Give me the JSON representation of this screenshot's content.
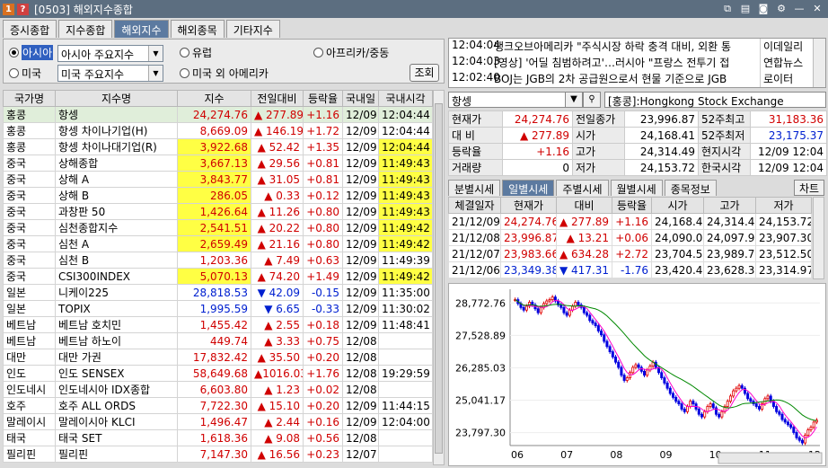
{
  "window": {
    "title": "[0503] 해외지수종합",
    "icon1": "1",
    "icon2": "?"
  },
  "tabs": [
    "증시종합",
    "지수종합",
    "해외지수",
    "해외종목",
    "기타지수"
  ],
  "filter": {
    "radio1": "아시아",
    "select1": "아시아 주요지수",
    "radio2": "유럽",
    "radio3": "아프리카/중동",
    "radio4": "미국",
    "select2": "미국 주요지수",
    "radio5": "미국 외 아메리카",
    "query": "조회"
  },
  "grid": {
    "headers": [
      "국가명",
      "지수명",
      "지수",
      "전일대비",
      "등락율",
      "국내일",
      "국내시각"
    ],
    "rows": [
      {
        "country": "홍콩",
        "name": "항셍",
        "value": "24,274.76",
        "change": "▲ 277.89",
        "rate": "+1.16",
        "date": "12/09",
        "time": "12:04:44"
      },
      {
        "country": "홍콩",
        "name": "항셍 차이나기업(H)",
        "value": "8,669.09",
        "change": "▲ 146.19",
        "rate": "+1.72",
        "date": "12/09",
        "time": "12:04:44"
      },
      {
        "country": "홍콩",
        "name": "항셍 차이나대기업(R)",
        "value": "3,922.68",
        "change": "▲ 52.42",
        "rate": "+1.35",
        "date": "12/09",
        "time": "12:04:44"
      },
      {
        "country": "중국",
        "name": "상해종합",
        "value": "3,667.13",
        "change": "▲ 29.56",
        "rate": "+0.81",
        "date": "12/09",
        "time": "11:49:43"
      },
      {
        "country": "중국",
        "name": "상해 A",
        "value": "3,843.77",
        "change": "▲ 31.05",
        "rate": "+0.81",
        "date": "12/09",
        "time": "11:49:43"
      },
      {
        "country": "중국",
        "name": "상해 B",
        "value": "286.05",
        "change": "▲ 0.33",
        "rate": "+0.12",
        "date": "12/09",
        "time": "11:49:43"
      },
      {
        "country": "중국",
        "name": "과창판 50",
        "value": "1,426.64",
        "change": "▲ 11.26",
        "rate": "+0.80",
        "date": "12/09",
        "time": "11:49:43"
      },
      {
        "country": "중국",
        "name": "심천종합지수",
        "value": "2,541.51",
        "change": "▲ 20.22",
        "rate": "+0.80",
        "date": "12/09",
        "time": "11:49:42"
      },
      {
        "country": "중국",
        "name": "심천 A",
        "value": "2,659.49",
        "change": "▲ 21.16",
        "rate": "+0.80",
        "date": "12/09",
        "time": "11:49:42"
      },
      {
        "country": "중국",
        "name": "심천 B",
        "value": "1,203.36",
        "change": "▲ 7.49",
        "rate": "+0.63",
        "date": "12/09",
        "time": "11:49:39"
      },
      {
        "country": "중국",
        "name": "CSI300INDEX",
        "value": "5,070.13",
        "change": "▲ 74.20",
        "rate": "+1.49",
        "date": "12/09",
        "time": "11:49:42"
      },
      {
        "country": "일본",
        "name": "니케이225",
        "value": "28,818.53",
        "change": "▼ 42.09",
        "rate": "-0.15",
        "date": "12/09",
        "time": "11:35:00"
      },
      {
        "country": "일본",
        "name": "TOPIX",
        "value": "1,995.59",
        "change": "▼ 6.65",
        "rate": "-0.33",
        "date": "12/09",
        "time": "11:30:02"
      },
      {
        "country": "베트남",
        "name": "베트남 호치민",
        "value": "1,455.42",
        "change": "▲ 2.55",
        "rate": "+0.18",
        "date": "12/09",
        "time": "11:48:41"
      },
      {
        "country": "베트남",
        "name": "베트남 하노이",
        "value": "449.74",
        "change": "▲ 3.33",
        "rate": "+0.75",
        "date": "12/08",
        "time": ""
      },
      {
        "country": "대만",
        "name": "대만 가권",
        "value": "17,832.42",
        "change": "▲ 35.50",
        "rate": "+0.20",
        "date": "12/08",
        "time": ""
      },
      {
        "country": "인도",
        "name": "인도 SENSEX",
        "value": "58,649.68",
        "change": "▲1016.03",
        "rate": "+1.76",
        "date": "12/08",
        "time": "19:29:59"
      },
      {
        "country": "인도네시",
        "name": "인도네시아 IDX종합",
        "value": "6,603.80",
        "change": "▲ 1.23",
        "rate": "+0.02",
        "date": "12/08",
        "time": ""
      },
      {
        "country": "호주",
        "name": "호주 ALL ORDS",
        "value": "7,722.30",
        "change": "▲ 15.10",
        "rate": "+0.20",
        "date": "12/09",
        "time": "11:44:15"
      },
      {
        "country": "말레이시",
        "name": "말레이시아 KLCI",
        "value": "1,496.47",
        "change": "▲ 2.44",
        "rate": "+0.16",
        "date": "12/09",
        "time": "12:04:00"
      },
      {
        "country": "태국",
        "name": "태국 SET",
        "value": "1,618.36",
        "change": "▲ 9.08",
        "rate": "+0.56",
        "date": "12/08",
        "time": ""
      },
      {
        "country": "필리핀",
        "name": "필리핀",
        "value": "7,147.30",
        "change": "▲ 16.56",
        "rate": "+0.23",
        "date": "12/07",
        "time": ""
      }
    ]
  },
  "news": [
    {
      "time": "12:04:04",
      "headline": "뱅크오브아메리카 \"주식시장 하락 충격 대비, 외환 통",
      "source": "이데일리"
    },
    {
      "time": "12:04:03",
      "headline": "[영상] '어딜 침범하려고'…러시아 \"프랑스 전투기 접",
      "source": "연합뉴스"
    },
    {
      "time": "12:02:40",
      "headline": "BOJ는 JGB의 2차 공급원으로서 현물 기준으로 JGB",
      "source": "로이터"
    }
  ],
  "search": {
    "value": "항셍",
    "exchange": "[홍콩]:Hongkong Stock Exchange"
  },
  "quote": {
    "rows": [
      [
        "현재가",
        "24,274.76",
        "전일종가",
        "23,996.87",
        "52주최고",
        "31,183.36"
      ],
      [
        "대 비",
        "▲ 277.89",
        "시가",
        "24,168.41",
        "52주최저",
        "23,175.37"
      ],
      [
        "등락율",
        "+1.16",
        "고가",
        "24,314.49",
        "현지시각",
        "12/09 12:04"
      ],
      [
        "거래량",
        "0",
        "저가",
        "24,153.72",
        "한국시각",
        "12/09 12:04"
      ]
    ]
  },
  "subtabs": [
    "분별시세",
    "일별시세",
    "주별시세",
    "월별시세",
    "종목정보"
  ],
  "chart_button": "차트",
  "daily": {
    "headers": [
      "체결일자",
      "현재가",
      "대비",
      "등락율",
      "시가",
      "고가",
      "저가"
    ],
    "rows": [
      [
        "21/12/09",
        "24,274.76",
        "▲ 277.89",
        "+1.16",
        "24,168.41",
        "24,314.49",
        "24,153.72"
      ],
      [
        "21/12/08",
        "23,996.87",
        "▲ 13.21",
        "+0.06",
        "24,090.02",
        "24,097.98",
        "23,907.30"
      ],
      [
        "21/12/07",
        "23,983.66",
        "▲ 634.28",
        "+2.72",
        "23,704.51",
        "23,989.78",
        "23,512.50"
      ],
      [
        "21/12/06",
        "23,349.38",
        "▼ 417.31",
        "-1.76",
        "23,420.44",
        "23,628.30",
        "23,314.97"
      ]
    ]
  },
  "chart_data": {
    "type": "candlestick",
    "yticks": [
      28772.76,
      27528.89,
      26285.03,
      25041.17,
      23797.3
    ],
    "ylim": [
      23300,
      29300
    ],
    "xticks": [
      "06",
      "07",
      "08",
      "09",
      "10",
      "11",
      "12"
    ],
    "close": [
      28900,
      28750,
      28600,
      28500,
      28650,
      28800,
      28700,
      28550,
      28400,
      28600,
      28750,
      28850,
      28900,
      29000,
      28850,
      28700,
      28600,
      28400,
      28300,
      28500,
      28650,
      28800,
      28700,
      28600,
      28400,
      28300,
      28100,
      28000,
      27900,
      27700,
      27550,
      27300,
      27100,
      26900,
      26700,
      26500,
      26300,
      26000,
      25800,
      25900,
      26100,
      26300,
      26400,
      26300,
      26150,
      26000,
      26200,
      26350,
      26500,
      26300,
      26100,
      25900,
      25700,
      25500,
      25300,
      25150,
      25000,
      24900,
      24700,
      24600,
      24800,
      25000,
      24900,
      24700,
      24500,
      24400,
      24600,
      24800,
      24900,
      24750,
      24500,
      24400,
      24600,
      24800,
      25000,
      25200,
      25400,
      25500,
      25600,
      25500,
      25300,
      25100,
      25000,
      24900,
      24800,
      24700,
      24900,
      25100,
      25200,
      25000,
      24800,
      24600,
      24500,
      24300,
      24200,
      24100,
      24000,
      23800,
      23600,
      23500,
      23400,
      23700,
      23900,
      24000,
      24200,
      24274.76
    ],
    "colors": {
      "up": "#e00000",
      "down": "#0000e0",
      "ma5": "#ff00cc",
      "ma20": "#008800"
    }
  }
}
